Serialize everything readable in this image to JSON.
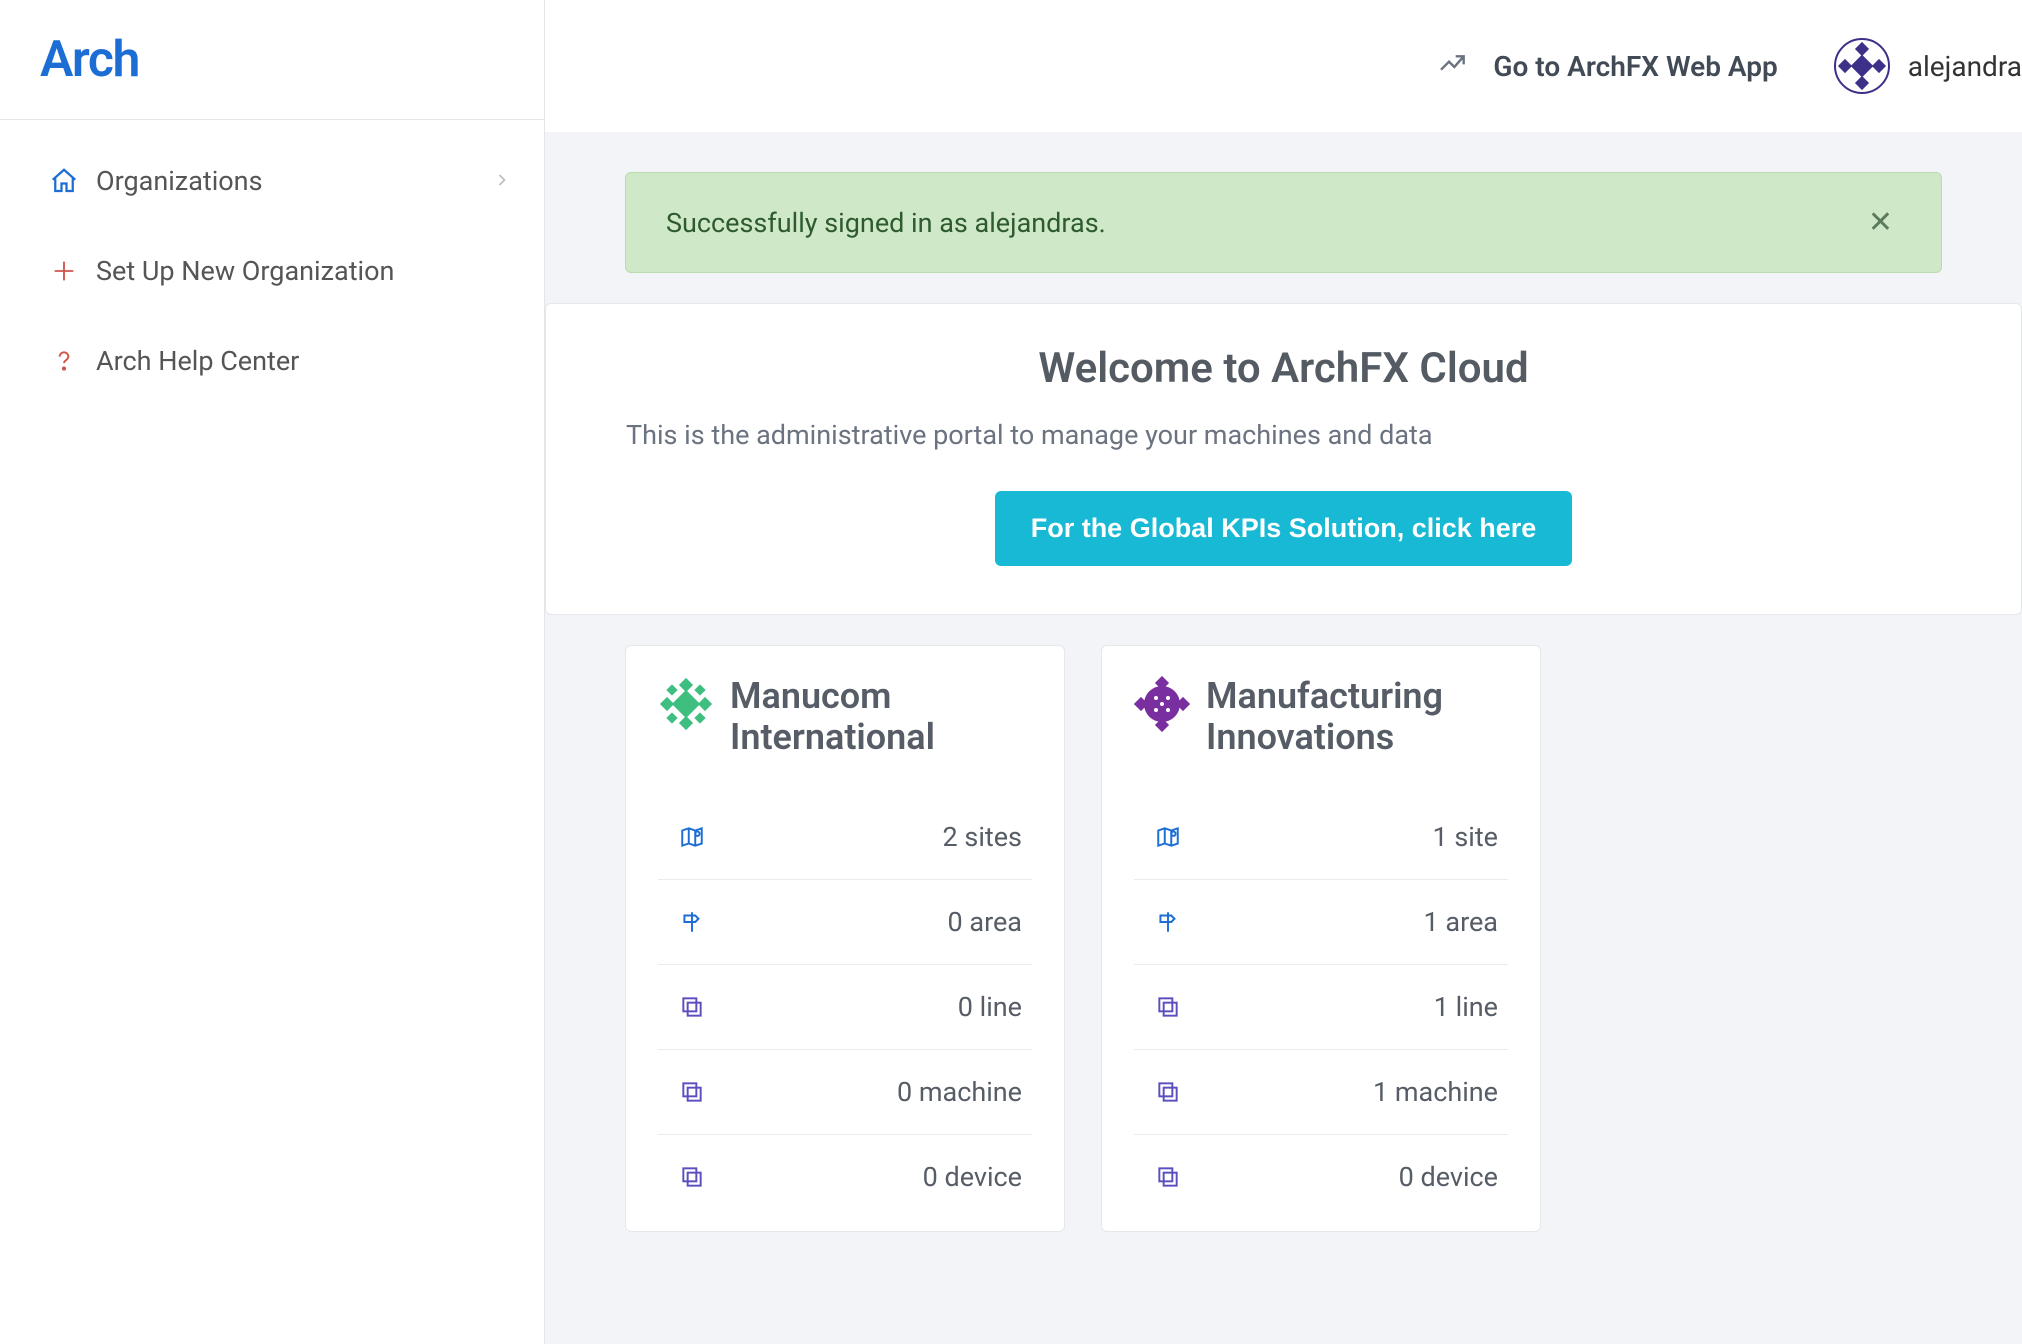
{
  "brand": {
    "name": "Arch"
  },
  "sidebar": {
    "items": [
      {
        "label": "Organizations"
      },
      {
        "label": "Set Up New Organization"
      },
      {
        "label": "Arch Help Center"
      }
    ]
  },
  "topbar": {
    "link_label": "Go to ArchFX Web App",
    "username": "alejandra"
  },
  "alert": {
    "message": "Successfully signed in as alejandras."
  },
  "welcome": {
    "title": "Welcome to ArchFX Cloud",
    "subtitle": "This is the administrative portal to manage your machines and data",
    "cta": "For the Global KPIs Solution, click here"
  },
  "orgs": [
    {
      "name": "Manucom International",
      "badge_color": "#3fbf7f",
      "stats": {
        "sites": "2 sites",
        "area": "0 area",
        "line": "0 line",
        "machine": "0 machine",
        "device": "0 device"
      }
    },
    {
      "name": "Manufacturing Innovations",
      "badge_color": "#7a2fa0",
      "stats": {
        "sites": "1 site",
        "area": "1 area",
        "line": "1 line",
        "machine": "1 machine",
        "device": "0 device"
      }
    }
  ]
}
